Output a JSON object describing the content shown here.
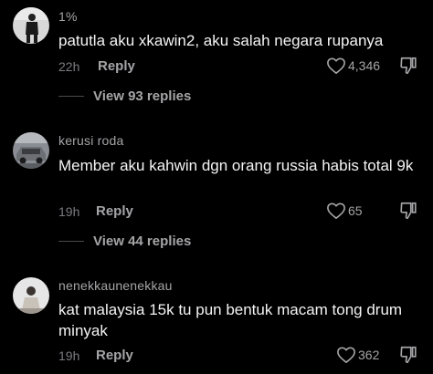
{
  "comments": [
    {
      "username": "1%",
      "text": "patutla aku xkawin2, aku salah negara rupanya",
      "time": "22h",
      "reply_label": "Reply",
      "likes": "4,346",
      "view_replies": "View 93 replies",
      "avatar_icon": "avatar-person-icon"
    },
    {
      "username": "kerusi roda",
      "text": "Member aku kahwin dgn orang russia habis total 9k",
      "time": "19h",
      "reply_label": "Reply",
      "likes": "65",
      "view_replies": "View 44 replies",
      "avatar_icon": "avatar-car-icon"
    },
    {
      "username": "nenekkaunenekkau",
      "text": "kat malaysia 15k tu pun bentuk macam tong drum minyak",
      "time": "19h",
      "reply_label": "Reply",
      "likes": "362",
      "avatar_icon": "avatar-person-icon"
    }
  ],
  "colors": {
    "background": "#000000",
    "primary_text": "#f4f4f4",
    "secondary_text": "#a5a5a8",
    "muted_text": "#7c7c80"
  }
}
